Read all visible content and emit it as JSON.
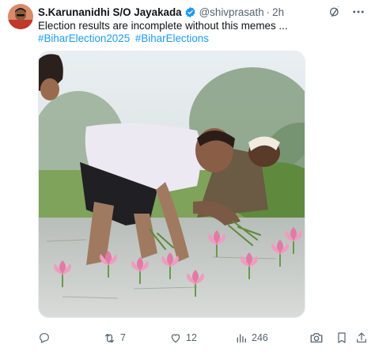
{
  "tweet": {
    "author_name": "S.Karunanidhi S/O Jayakada",
    "handle": "@shivprasath",
    "separator": "·",
    "time": "2h",
    "text": "Election results are incomplete without this memes ...",
    "hashtags": [
      "#BiharElection2025",
      "#BiharElections"
    ]
  },
  "icons": {
    "verified": "verified-badge-icon",
    "grok": "grok-icon",
    "more": "more-icon",
    "reply": "reply-icon",
    "retweet": "retweet-icon",
    "like": "like-icon",
    "views": "views-icon",
    "camera": "camera-icon",
    "bookmark": "bookmark-icon",
    "share": "share-icon"
  },
  "actions": {
    "retweets": "7",
    "likes": "12",
    "views": "246"
  },
  "colors": {
    "accent": "#1d9bf0",
    "muted": "#536471",
    "text": "#0f1419"
  }
}
